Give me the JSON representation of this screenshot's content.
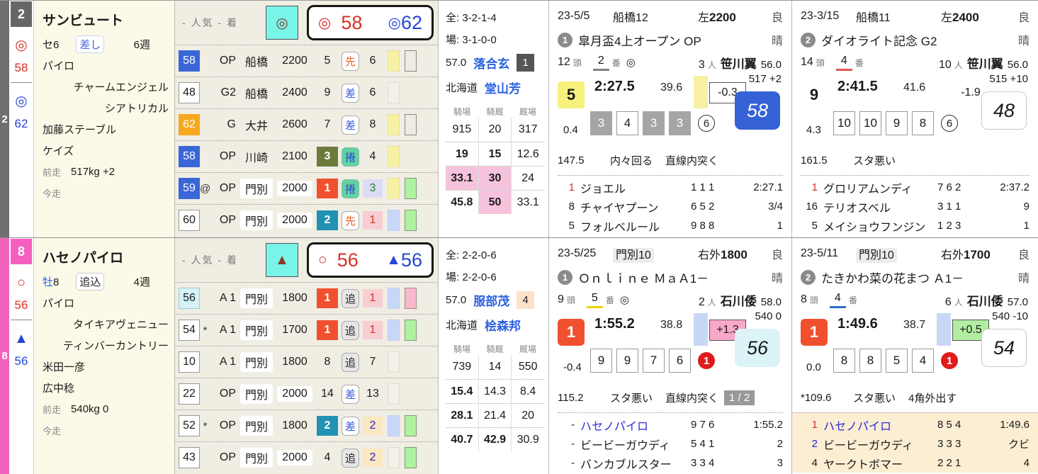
{
  "horses": [
    {
      "num": "2",
      "strip_style": "background:#6f6f6f",
      "numbox_style": "background:#666666",
      "marks": {
        "m1": "◎",
        "v1": "58",
        "m2": "◎",
        "v2": "62"
      },
      "info": {
        "name": "サンビュート",
        "sex": "セ",
        "sex_cls": "sx",
        "age": "6",
        "style_chip": "差し",
        "style_chip_cls": "chip blue",
        "weeks": "6週",
        "sire": "パイロ",
        "dam": "チャームエンジェル",
        "damsire": "シアトリカル",
        "owner": "加藤ステーブル",
        "breeder": "ケイズ",
        "prev_label": "前走",
        "prev_value": "517kg  +2",
        "now_label": "今走"
      },
      "races_header": {
        "label": "-  人気  -  着",
        "box_mark": "◎",
        "m1": "◎",
        "v1": "58",
        "m2": "◎",
        "v2": "62"
      },
      "races": [
        {
          "w": "58",
          "w_cls": "wb blue",
          "pre": "",
          "cls": "OP",
          "venue": "船橋",
          "venue_cls": "pv",
          "dist": "2200",
          "dist_cls": "pv wd",
          "pos": "5",
          "pos_cls": "rpos",
          "style": "先",
          "style_cls": "stb sen",
          "fin": "6",
          "fin_cls": "rfin",
          "b1": "blk yellow",
          "b2": "blk graywhite"
        },
        {
          "w": "48",
          "w_cls": "wb",
          "pre": "",
          "cls": "G2",
          "venue": "船橋",
          "venue_cls": "pv",
          "dist": "2400",
          "dist_cls": "pv wd",
          "pos": "9",
          "pos_cls": "rpos",
          "style": "差",
          "style_cls": "stb sashi",
          "fin": "6",
          "fin_cls": "rfin",
          "b1": "blk faint",
          "b2": "blk none"
        },
        {
          "w": "62",
          "w_cls": "wb orange",
          "pre": "",
          "cls": "G",
          "venue": "大井",
          "venue_cls": "pv",
          "dist": "2600",
          "dist_cls": "pv wd",
          "pos": "7",
          "pos_cls": "rpos",
          "style": "差",
          "style_cls": "stb sashi",
          "fin": "8",
          "fin_cls": "rfin",
          "b1": "blk yellow",
          "b2": "blk graywhite"
        },
        {
          "w": "58",
          "w_cls": "wb blue",
          "pre": "",
          "cls": "OP",
          "venue": "川崎",
          "venue_cls": "pv",
          "dist": "2100",
          "dist_cls": "pv wd",
          "pos": "3",
          "pos_cls": "rpos p3",
          "style": "捲",
          "style_cls": "stb mak",
          "fin": "4",
          "fin_cls": "rfin",
          "b1": "blk yellow",
          "b2": "blk none"
        },
        {
          "w": "59",
          "w_cls": "wb blue",
          "pre": "@",
          "cls": "OP",
          "venue": "門別",
          "venue_cls": "pv hl",
          "dist": "2000",
          "dist_cls": "pv wd hl",
          "pos": "1",
          "pos_cls": "rpos p1",
          "style": "捲",
          "style_cls": "stb mak",
          "fin": "3",
          "fin_cls": "rfin green bglav",
          "b1": "blk yellow",
          "b2": "blk green"
        },
        {
          "w": "60",
          "w_cls": "wb",
          "pre": "",
          "cls": "OP",
          "venue": "門別",
          "venue_cls": "pv hl",
          "dist": "2000",
          "dist_cls": "pv wd hl",
          "pos": "2",
          "pos_cls": "rpos p2",
          "style": "先",
          "style_cls": "stb sen",
          "fin": "1",
          "fin_cls": "rfin red bgpink",
          "b1": "blk lav",
          "b2": "blk green"
        }
      ],
      "stats": {
        "zen": "全: 3-2-1-4",
        "ba": "場: 3-1-0-0",
        "weight": "57.0",
        "jockey": "落合玄",
        "badge": "1",
        "badge_cls": "jbadge dark",
        "region": "北海道",
        "trainer": "堂山芳",
        "h1": "騎場",
        "h2": "騎厩",
        "h3": "厩場",
        "rows": [
          {
            "rc": "strow",
            "c1": "915",
            "k1": "sc",
            "c2": "20",
            "k2": "sc",
            "c3": "317",
            "k3": "sc"
          },
          {
            "rc": "strow dot",
            "c1": "19",
            "k1": "sc b",
            "c2": "15",
            "k2": "sc b",
            "c3": "12.6",
            "k3": "sc"
          },
          {
            "rc": "strow dot",
            "c1": "33.1",
            "k1": "sc b pk",
            "c2": "30",
            "k2": "sc b pk",
            "c3": "24",
            "k3": "sc"
          },
          {
            "rc": "strow dot",
            "c1": "45.8",
            "k1": "sc b",
            "c2": "50",
            "k2": "sc b pk",
            "c3": "33.1",
            "k3": "sc"
          }
        ]
      },
      "panels": [
        {
          "date": "23-5/5",
          "venue": "船橋12",
          "venue_cls": "vn",
          "dd": "左",
          "dist": "2200",
          "cond": "良",
          "seq": "1",
          "race": "皐月盃4上オープン OP",
          "weather": "晴",
          "heads": "12",
          "heads_l": "頭",
          "gate": "2",
          "gate_style": "border-bottom:3px solid #808080",
          "gate_l": "番",
          "mark": "◎",
          "pop": "3",
          "pop_l": "人",
          "jockey": "笹川翼",
          "jw": "56.0",
          "pos": "5",
          "pos_cls": "bpos yellow",
          "time": "2:27.5",
          "f3": "39.6",
          "mblk_cls": "mblk yellow",
          "margin": "-0.3",
          "mbox_cls": "mbox",
          "hw": "517 +2",
          "idx": "58",
          "idx_cls": "pidx blue",
          "sub": "0.4",
          "corners": [
            {
              "v": "3",
              "cls": "cnr gray"
            },
            {
              "v": "4",
              "cls": "cnr"
            },
            {
              "v": "3",
              "cls": "cnr gray"
            },
            {
              "v": "3",
              "cls": "cnr gray"
            }
          ],
          "pace": "6",
          "pace_cls": "pace out",
          "rindex": "147.5",
          "cm1": "内々回る",
          "cm2": "直線内突く",
          "badge": "",
          "badge_cls": "rbadge hide",
          "fin_cls": "finishers",
          "finishers": [
            {
              "no": "1",
              "no_cls": "fno red",
              "name": "ジョエル",
              "name_cls": "fname",
              "pos": "1 1 1",
              "time": "2:27.1"
            },
            {
              "no": "8",
              "no_cls": "fno",
              "name": "チャイヤプーン",
              "name_cls": "fname",
              "pos": "6 5 2",
              "time": "3/4"
            },
            {
              "no": "5",
              "no_cls": "fno",
              "name": "フォルベルール",
              "name_cls": "fname",
              "pos": "9 8 8",
              "time": "1"
            }
          ]
        },
        {
          "date": "23-3/15",
          "venue": "船橋11",
          "venue_cls": "vn",
          "dd": "左",
          "dist": "2400",
          "cond": "良",
          "seq": "2",
          "race": "ダイオライト記念 G2",
          "weather": "晴",
          "heads": "14",
          "heads_l": "頭",
          "gate": "4",
          "gate_style": "border-bottom:3px solid #e05555",
          "gate_l": "番",
          "mark": "",
          "pop": "10",
          "pop_l": "人",
          "jockey": "笹川翼",
          "jw": "56.0",
          "pos": "9",
          "pos_cls": "bpos plain",
          "time": "2:41.5",
          "f3": "41.6",
          "mblk_cls": "mblk hide",
          "margin": "-1.9",
          "mbox_cls": "mbox plain",
          "hw": "515 +10",
          "idx": "48",
          "idx_cls": "pidx out",
          "sub": "4.3",
          "corners": [
            {
              "v": "10",
              "cls": "cnr"
            },
            {
              "v": "10",
              "cls": "cnr"
            },
            {
              "v": "9",
              "cls": "cnr"
            },
            {
              "v": "8",
              "cls": "cnr"
            }
          ],
          "pace": "6",
          "pace_cls": "pace out",
          "rindex": "161.5",
          "cm1": "スタ悪い",
          "cm2": "",
          "badge": "",
          "badge_cls": "rbadge hide",
          "fin_cls": "finishers",
          "finishers": [
            {
              "no": "1",
              "no_cls": "fno red",
              "name": "グロリアムンディ",
              "name_cls": "fname",
              "pos": "7 6 2",
              "time": "2:37.2"
            },
            {
              "no": "16",
              "no_cls": "fno",
              "name": "テリオスベル",
              "name_cls": "fname",
              "pos": "3 1 1",
              "time": "9"
            },
            {
              "no": "5",
              "no_cls": "fno",
              "name": "メイショウフンジン",
              "name_cls": "fname",
              "pos": "1 2 3",
              "time": "1"
            }
          ]
        }
      ]
    },
    {
      "num": "8",
      "strip_style": "background:#f263bd",
      "numbox_style": "background:#f55fc0",
      "marks": {
        "m1": "○",
        "v1": "56",
        "m2": "▲",
        "v2": "56"
      },
      "info": {
        "name": "ハセノパイロ",
        "sex": "牡",
        "sex_cls": "sx blue",
        "age": "8",
        "style_chip": "追込",
        "style_chip_cls": "chip gray",
        "weeks": "4週",
        "sire": "パイロ",
        "dam": "タイキアヴェニュー",
        "damsire": "ティンバーカントリー",
        "owner": "米田一彦",
        "breeder": "広中稔",
        "prev_label": "前走",
        "prev_value": "540kg  0",
        "now_label": "今走"
      },
      "races_header": {
        "label": "-  人気  -  着",
        "box_mark": "▲",
        "m1": "○",
        "v1": "56",
        "m2": "▲",
        "v2": "56"
      },
      "races": [
        {
          "w": "56",
          "w_cls": "wb cyan",
          "pre": "",
          "cls": "A 1",
          "venue": "門別",
          "venue_cls": "pv hl",
          "dist": "1800",
          "dist_cls": "pv wd",
          "pos": "1",
          "pos_cls": "rpos p1",
          "style": "追",
          "style_cls": "stb oi",
          "fin": "1",
          "fin_cls": "rfin red bgpink",
          "b1": "blk lav",
          "b2": "blk pink"
        },
        {
          "w": "54",
          "w_cls": "wb",
          "pre": "*",
          "cls": "A 1",
          "venue": "門別",
          "venue_cls": "pv hl",
          "dist": "1700",
          "dist_cls": "pv wd",
          "pos": "1",
          "pos_cls": "rpos p1",
          "style": "追",
          "style_cls": "stb oi",
          "fin": "1",
          "fin_cls": "rfin red bgpink",
          "b1": "blk lav",
          "b2": "blk green"
        },
        {
          "w": "10",
          "w_cls": "wb",
          "pre": "",
          "cls": "A 1",
          "venue": "門別",
          "venue_cls": "pv hl",
          "dist": "1800",
          "dist_cls": "pv wd",
          "pos": "8",
          "pos_cls": "rpos",
          "style": "追",
          "style_cls": "stb oi",
          "fin": "7",
          "fin_cls": "rfin",
          "b1": "blk faint",
          "b2": "blk none"
        },
        {
          "w": "22",
          "w_cls": "wb",
          "pre": "",
          "cls": "OP",
          "venue": "門別",
          "venue_cls": "pv hl",
          "dist": "2000",
          "dist_cls": "pv wd hl",
          "pos": "14",
          "pos_cls": "rpos",
          "style": "差",
          "style_cls": "stb sashi",
          "fin": "13",
          "fin_cls": "rfin",
          "b1": "blk faint",
          "b2": "blk none"
        },
        {
          "w": "52",
          "w_cls": "wb",
          "pre": "*",
          "cls": "OP",
          "venue": "門別",
          "venue_cls": "pv hl",
          "dist": "1800",
          "dist_cls": "pv wd",
          "pos": "2",
          "pos_cls": "rpos p2",
          "style": "差",
          "style_cls": "stb sashi",
          "fin": "2",
          "fin_cls": "rfin blue bgbeige",
          "b1": "blk lav",
          "b2": "blk green"
        },
        {
          "w": "43",
          "w_cls": "wb",
          "pre": "",
          "cls": "OP",
          "venue": "門別",
          "venue_cls": "pv hl",
          "dist": "2000",
          "dist_cls": "pv wd hl",
          "pos": "4",
          "pos_cls": "rpos",
          "style": "追",
          "style_cls": "stb oi",
          "fin": "2",
          "fin_cls": "rfin blue bgbeige",
          "b1": "blk faint",
          "b2": "blk green"
        }
      ],
      "stats": {
        "zen": "全: 2-2-0-6",
        "ba": "場: 2-2-0-6",
        "weight": "57.0",
        "jockey": "服部茂",
        "badge": "4",
        "badge_cls": "jbadge peach",
        "region": "北海道",
        "trainer": "桧森邦",
        "h1": "騎場",
        "h2": "騎厩",
        "h3": "厩場",
        "rows": [
          {
            "rc": "strow",
            "c1": "739",
            "k1": "sc",
            "c2": "14",
            "k2": "sc",
            "c3": "550",
            "k3": "sc"
          },
          {
            "rc": "strow dot",
            "c1": "15.4",
            "k1": "sc b",
            "c2": "14.3",
            "k2": "sc",
            "c3": "8.4",
            "k3": "sc"
          },
          {
            "rc": "strow dot",
            "c1": "28.1",
            "k1": "sc b",
            "c2": "21.4",
            "k2": "sc",
            "c3": "20",
            "k3": "sc"
          },
          {
            "rc": "strow dot",
            "c1": "40.7",
            "k1": "sc b",
            "c2": "42.9",
            "k2": "sc b",
            "c3": "30.9",
            "k3": "sc"
          }
        ]
      },
      "panels": [
        {
          "date": "23-5/25",
          "venue": "門別10",
          "venue_cls": "vn hl",
          "dd": "右外",
          "dist": "1800",
          "cond": "良",
          "seq": "1",
          "race": "Ｏｎｌｉｎｅ ＭａＡ1－",
          "weather": "晴",
          "heads": "9",
          "heads_l": "頭",
          "gate": "5",
          "gate_style": "border-bottom:3px solid #f2d200",
          "gate_l": "番",
          "mark": "◎",
          "pop": "2",
          "pop_l": "人",
          "jockey": "石川倭",
          "jw": "58.0",
          "pos": "1",
          "pos_cls": "bpos red",
          "time": "1:55.2",
          "f3": "38.8",
          "mblk_cls": "mblk lav",
          "margin": "+1.3",
          "mbox_cls": "mbox pink",
          "hw": "540 0",
          "idx": "56",
          "idx_cls": "pidx cyan",
          "sub": "-0.4",
          "corners": [
            {
              "v": "9",
              "cls": "cnr"
            },
            {
              "v": "9",
              "cls": "cnr"
            },
            {
              "v": "7",
              "cls": "cnr"
            },
            {
              "v": "6",
              "cls": "cnr"
            }
          ],
          "pace": "1",
          "pace_cls": "pace fill",
          "rindex": "115.2",
          "cm1": "スタ悪い",
          "cm2": "直線内突く",
          "badge": "1 / 2",
          "badge_cls": "rbadge",
          "fin_cls": "finishers",
          "finishers": [
            {
              "no": "-",
              "no_cls": "fno",
              "name": "ハセノパイロ",
              "name_cls": "fname link",
              "pos": "9 7 6",
              "time": "1:55.2"
            },
            {
              "no": "-",
              "no_cls": "fno",
              "name": "ビービーガウディ",
              "name_cls": "fname",
              "pos": "5 4 1",
              "time": "2"
            },
            {
              "no": "-",
              "no_cls": "fno",
              "name": "バンカブルスター",
              "name_cls": "fname",
              "pos": "3 3 4",
              "time": "3"
            }
          ]
        },
        {
          "date": "23-5/11",
          "venue": "門別10",
          "venue_cls": "vn hl",
          "dd": "右外",
          "dist": "1700",
          "cond": "良",
          "seq": "2",
          "race": "たきかわ菜の花まつ Ａ1－",
          "weather": "晴",
          "heads": "8",
          "heads_l": "頭",
          "gate": "4",
          "gate_style": "border-bottom:3px solid #2c6fc9",
          "gate_l": "番",
          "mark": "",
          "pop": "6",
          "pop_l": "人",
          "jockey": "石川倭",
          "jw": "57.0",
          "pos": "1",
          "pos_cls": "bpos red",
          "time": "1:49.6",
          "f3": "38.7",
          "mblk_cls": "mblk lav",
          "margin": "+0.5",
          "mbox_cls": "mbox green",
          "hw": "540 -10",
          "idx": "54",
          "idx_cls": "pidx out",
          "sub": "0.0",
          "corners": [
            {
              "v": "8",
              "cls": "cnr"
            },
            {
              "v": "8",
              "cls": "cnr"
            },
            {
              "v": "5",
              "cls": "cnr"
            },
            {
              "v": "4",
              "cls": "cnr"
            }
          ],
          "pace": "1",
          "pace_cls": "pace fill",
          "rindex": "*109.6",
          "cm1": "スタ悪い",
          "cm2": "4角外出す",
          "badge": "",
          "badge_cls": "rbadge hide",
          "fin_cls": "finishers beige",
          "finishers": [
            {
              "no": "1",
              "no_cls": "fno red",
              "name": "ハセノパイロ",
              "name_cls": "fname link",
              "pos": "8 5 4",
              "time": "1:49.6"
            },
            {
              "no": "2",
              "no_cls": "fno blue",
              "name": "ビービーガウディ",
              "name_cls": "fname",
              "pos": "3 3 3",
              "time": "クビ"
            },
            {
              "no": "4",
              "no_cls": "fno",
              "name": "ヤークトボマー",
              "name_cls": "fname",
              "pos": "2 2 1",
              "time": "4"
            }
          ]
        }
      ]
    }
  ]
}
